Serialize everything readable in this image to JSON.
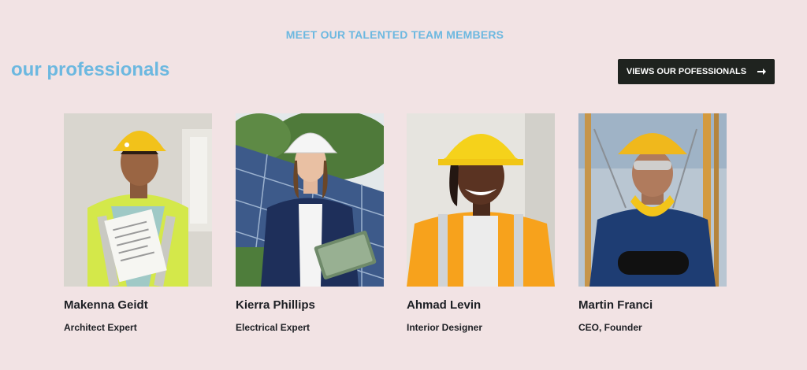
{
  "section": {
    "eyebrow": "MEET OUR TALENTED TEAM MEMBERS",
    "title": "our professionals",
    "cta_label": "VIEWS OUR POFESSIONALS",
    "cta_icon": "arrow-right-icon"
  },
  "colors": {
    "background": "#f2e3e4",
    "accent": "#6cb8e0",
    "button_bg": "#1f231f"
  },
  "team": [
    {
      "name": "Makenna Geidt",
      "role": "Architect Expert"
    },
    {
      "name": "Kierra Phillips",
      "role": "Electrical Expert"
    },
    {
      "name": "Ahmad Levin",
      "role": "Interior Designer"
    },
    {
      "name": "Martin Franci",
      "role": "CEO, Founder"
    }
  ]
}
